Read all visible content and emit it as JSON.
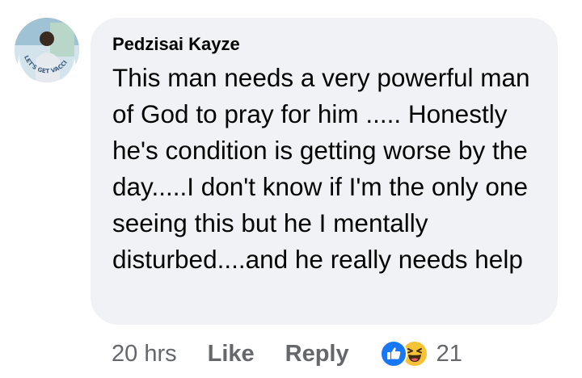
{
  "comment": {
    "author": "Pedzisai Kayze",
    "text": "This man needs a very powerful man of God to pray for him ..... Honestly he's condition is getting worse by the day.....I don't know if I'm the only one seeing this but he I mentally disturbed....and he really needs help",
    "avatar_frame_text": "LET'S GET VACCINATED"
  },
  "actions": {
    "timestamp": "20 hrs",
    "like_label": "Like",
    "reply_label": "Reply",
    "reaction_count": "21",
    "reaction_icons": [
      "like-icon",
      "haha-icon"
    ]
  },
  "colors": {
    "bubble": "#f0f2f5",
    "text": "#050505",
    "meta": "#65676b",
    "like_blue": "#1877f2",
    "haha_yellow": "#f7c336"
  }
}
